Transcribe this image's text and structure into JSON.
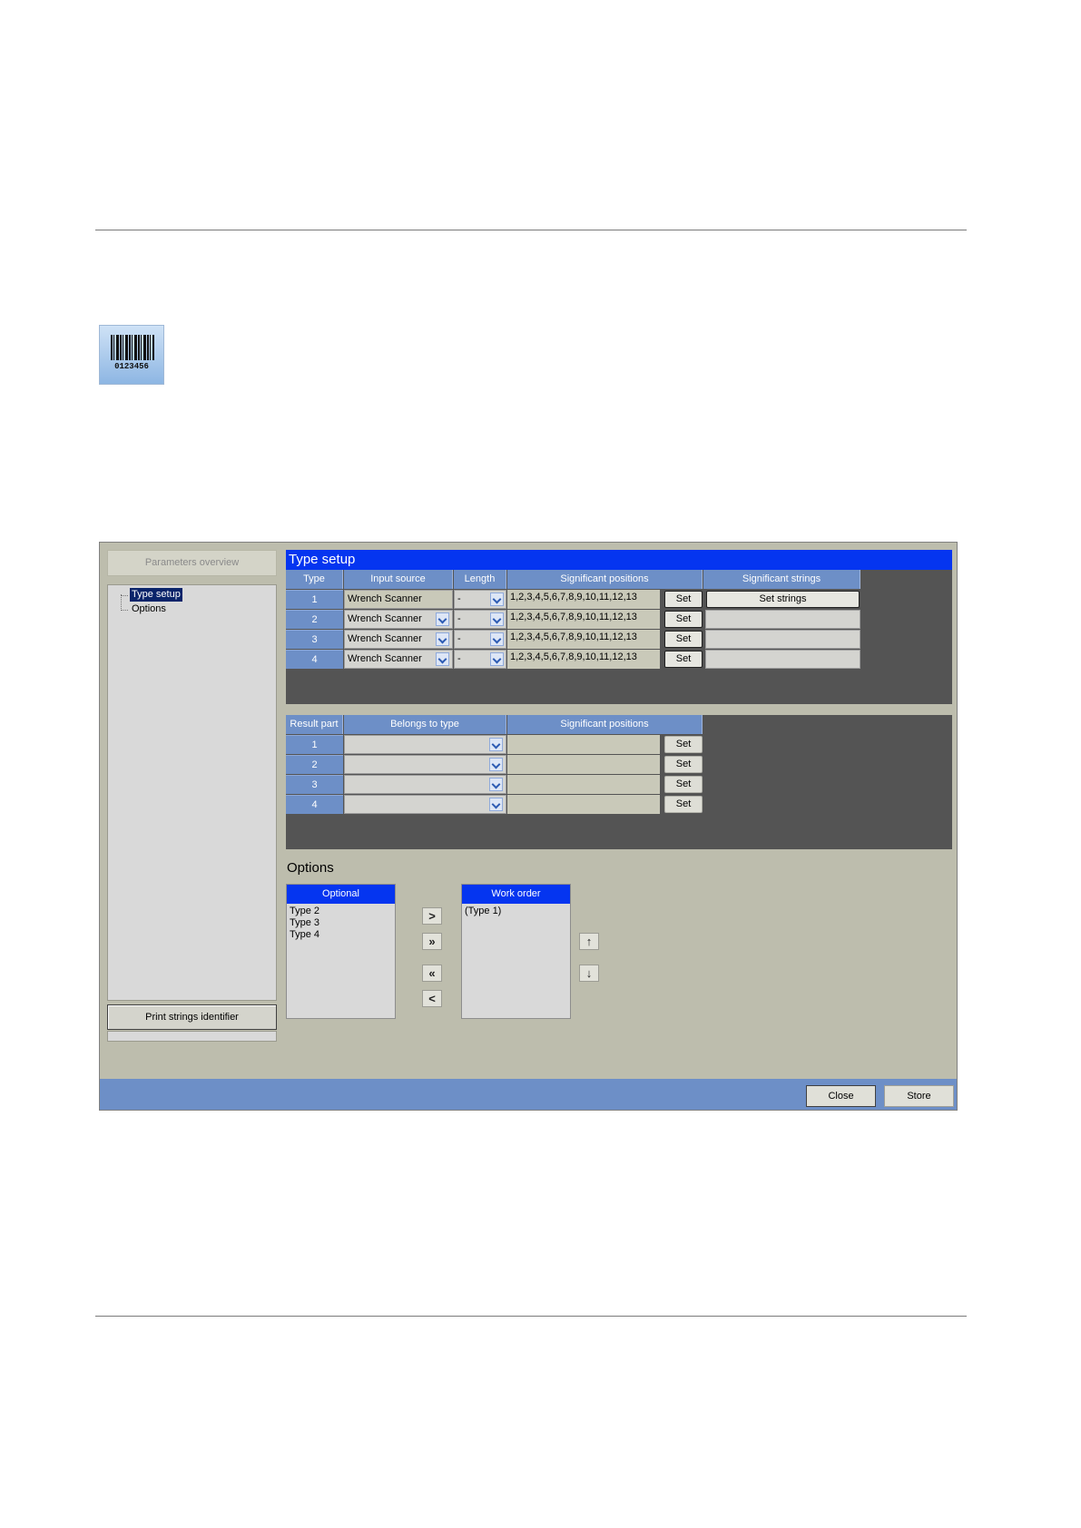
{
  "icon": {
    "name": "barcode-icon",
    "digits": "0123456"
  },
  "left_panel": {
    "overview_button": "Parameters overview",
    "tree": [
      "Type setup",
      "Options"
    ],
    "print_button": "Print strings identifier"
  },
  "type_setup": {
    "title": "Type setup",
    "headers": [
      "Type",
      "Input source",
      "Length",
      "Significant positions",
      "Significant strings"
    ],
    "rows": [
      {
        "type": "1",
        "input_source": "Wrench Scanner",
        "length": "-",
        "positions": "1,2,3,4,5,6,7,8,9,10,11,12,13",
        "set": "Set",
        "strings": "Set strings"
      },
      {
        "type": "2",
        "input_source": "Wrench Scanner",
        "length": "-",
        "positions": "1,2,3,4,5,6,7,8,9,10,11,12,13",
        "set": "Set",
        "strings": ""
      },
      {
        "type": "3",
        "input_source": "Wrench Scanner",
        "length": "-",
        "positions": "1,2,3,4,5,6,7,8,9,10,11,12,13",
        "set": "Set",
        "strings": ""
      },
      {
        "type": "4",
        "input_source": "Wrench Scanner",
        "length": "-",
        "positions": "1,2,3,4,5,6,7,8,9,10,11,12,13",
        "set": "Set",
        "strings": ""
      }
    ]
  },
  "result_parts": {
    "headers": [
      "Result part",
      "Belongs to type",
      "Significant positions"
    ],
    "rows": [
      {
        "part": "1",
        "type": "",
        "positions": "",
        "set": "Set"
      },
      {
        "part": "2",
        "type": "",
        "positions": "",
        "set": "Set"
      },
      {
        "part": "3",
        "type": "",
        "positions": "",
        "set": "Set"
      },
      {
        "part": "4",
        "type": "",
        "positions": "",
        "set": "Set"
      }
    ]
  },
  "options": {
    "title": "Options",
    "optional_header": "Optional",
    "optional_items": [
      "Type 2",
      "Type 3",
      "Type 4"
    ],
    "work_order_header": "Work order",
    "work_order_items": [
      "(Type 1)"
    ],
    "move_buttons": [
      ">",
      "»",
      "«",
      "<"
    ],
    "order_buttons": [
      "↑",
      "↓"
    ]
  },
  "footer": {
    "close": "Close",
    "store": "Store"
  }
}
